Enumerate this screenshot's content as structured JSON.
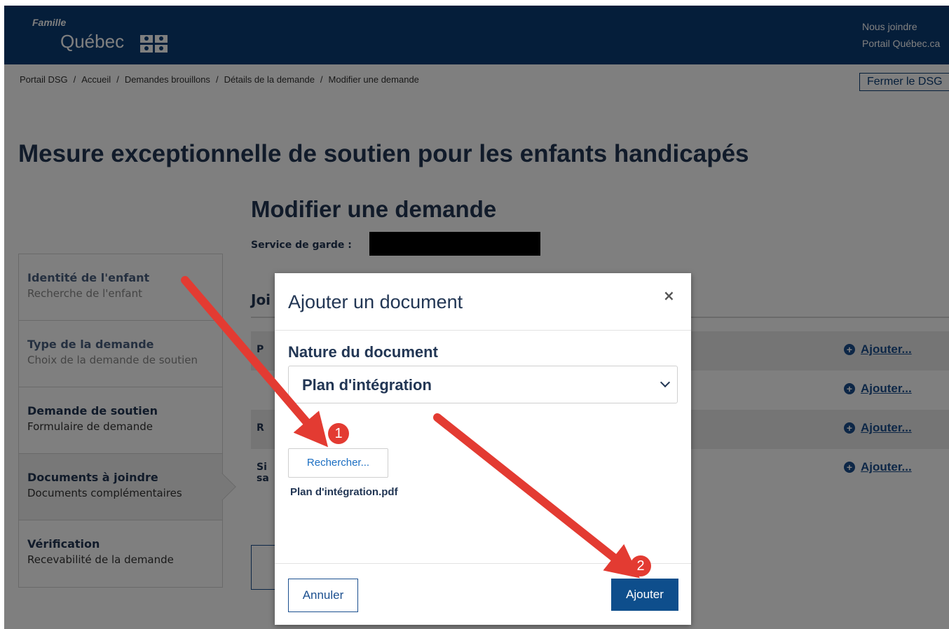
{
  "header": {
    "logo_famille": "Famille",
    "logo_quebec": "Québec",
    "link_nous_joindre": "Nous joindre",
    "link_portail": "Portail Québec.ca",
    "brand_color": "#0a3c75"
  },
  "breadcrumb": {
    "items": [
      "Portail DSG",
      "Accueil",
      "Demandes brouillons",
      "Détails de la demande",
      "Modifier une demande"
    ],
    "separator": "/"
  },
  "close_dsg_label": "Fermer le DSG",
  "page_title": "Mesure exceptionnelle de soutien pour les enfants handicapés",
  "section_title": "Modifier une demande",
  "service_label": "Service de garde :",
  "sidebar": {
    "steps": [
      {
        "title": "Identité de l'enfant",
        "subtitle": "Recherche de l'enfant"
      },
      {
        "title": "Type de la demande",
        "subtitle": "Choix de la demande de soutien"
      },
      {
        "title": "Demande de soutien",
        "subtitle": "Formulaire de demande"
      },
      {
        "title": "Documents à joindre",
        "subtitle": "Documents complémentaires"
      },
      {
        "title": "Vérification",
        "subtitle": "Recevabilité de la demande"
      }
    ]
  },
  "documents": {
    "heading": "Joi",
    "rows": [
      {
        "text": "P",
        "add_label": "Ajouter..."
      },
      {
        "text": "",
        "add_label": "Ajouter..."
      },
      {
        "text": "R",
        "add_label": "Ajouter..."
      },
      {
        "text": "Si",
        "text2": "sa",
        "add_label": "Ajouter..."
      }
    ]
  },
  "modal": {
    "title": "Ajouter un document",
    "close_glyph": "×",
    "nature_label": "Nature du document",
    "nature_value": "Plan d'intégration",
    "browse_label": "Rechercher...",
    "file_name": "Plan d'intégration.pdf",
    "cancel_label": "Annuler",
    "add_label": "Ajouter"
  },
  "annotations": {
    "marker_1": "1",
    "marker_2": "2",
    "arrow_color": "#e33b32"
  }
}
